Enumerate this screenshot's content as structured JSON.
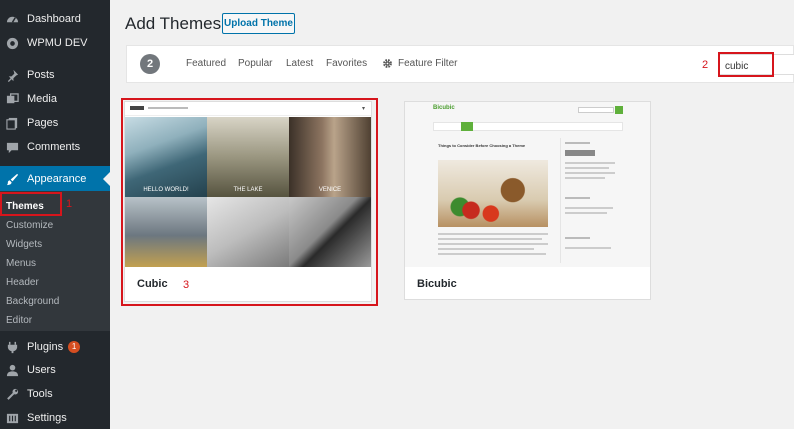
{
  "sidebar": {
    "items": [
      {
        "label": "Dashboard",
        "icon": "dashboard-icon"
      },
      {
        "label": "WPMU DEV",
        "icon": "wpmu-dev-icon"
      },
      {
        "label": "Posts",
        "icon": "pin-icon"
      },
      {
        "label": "Media",
        "icon": "media-icon"
      },
      {
        "label": "Pages",
        "icon": "pages-icon"
      },
      {
        "label": "Comments",
        "icon": "comment-icon"
      },
      {
        "label": "Appearance",
        "icon": "brush-icon"
      },
      {
        "label": "Plugins",
        "icon": "plugin-icon",
        "badge": "1"
      },
      {
        "label": "Users",
        "icon": "users-icon"
      },
      {
        "label": "Tools",
        "icon": "wrench-icon"
      },
      {
        "label": "Settings",
        "icon": "settings-icon"
      }
    ],
    "submenu": [
      "Themes",
      "Customize",
      "Widgets",
      "Menus",
      "Header",
      "Background",
      "Editor"
    ]
  },
  "header": {
    "title": "Add Themes",
    "upload_label": "Upload Theme"
  },
  "filter": {
    "count": "2",
    "links": [
      "Featured",
      "Popular",
      "Latest",
      "Favorites"
    ],
    "feature_filter": "Feature Filter",
    "search_value": "cubic"
  },
  "annotations": {
    "themes": "1",
    "search": "2",
    "cubic": "3"
  },
  "themes": [
    {
      "name": "Cubic",
      "tiles": [
        "HELLO WORLD!",
        "THE LAKE",
        "VENICE"
      ]
    },
    {
      "name": "Bicubic",
      "preview_logo": "Bicubic",
      "preview_post_title": "Things to Consider Before Choosing a Theme"
    }
  ]
}
